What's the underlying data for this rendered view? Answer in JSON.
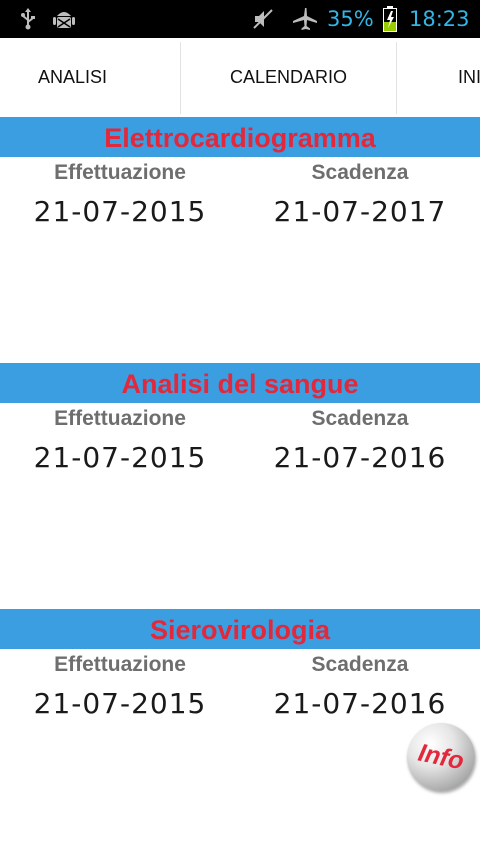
{
  "status_bar": {
    "battery_percent": "35%",
    "time": "18:23",
    "icons": [
      "usb-icon",
      "android-debug-icon",
      "muted-icon",
      "airplane-mode-icon",
      "battery-charging-icon"
    ],
    "color": "#33b5e5"
  },
  "tabs": [
    {
      "label": "ANALISI"
    },
    {
      "label": "CALENDARIO"
    },
    {
      "label": "INI"
    }
  ],
  "sections": [
    {
      "title": "Elettrocardiogramma",
      "performed_label": "Effettuazione",
      "performed_date": "21-07-2015",
      "expiry_label": "Scadenza",
      "expiry_date": "21-07-2017"
    },
    {
      "title": "Analisi del sangue",
      "performed_label": "Effettuazione",
      "performed_date": "21-07-2015",
      "expiry_label": "Scadenza",
      "expiry_date": "21-07-2016"
    },
    {
      "title": "Sierovirologia",
      "performed_label": "Effettuazione",
      "performed_date": "21-07-2015",
      "expiry_label": "Scadenza",
      "expiry_date": "21-07-2016"
    }
  ],
  "info_button": {
    "label": "Info"
  },
  "colors": {
    "header_bar": "#3b9ee0",
    "section_title": "#e2283a",
    "label_gray": "#6e6e6e"
  }
}
